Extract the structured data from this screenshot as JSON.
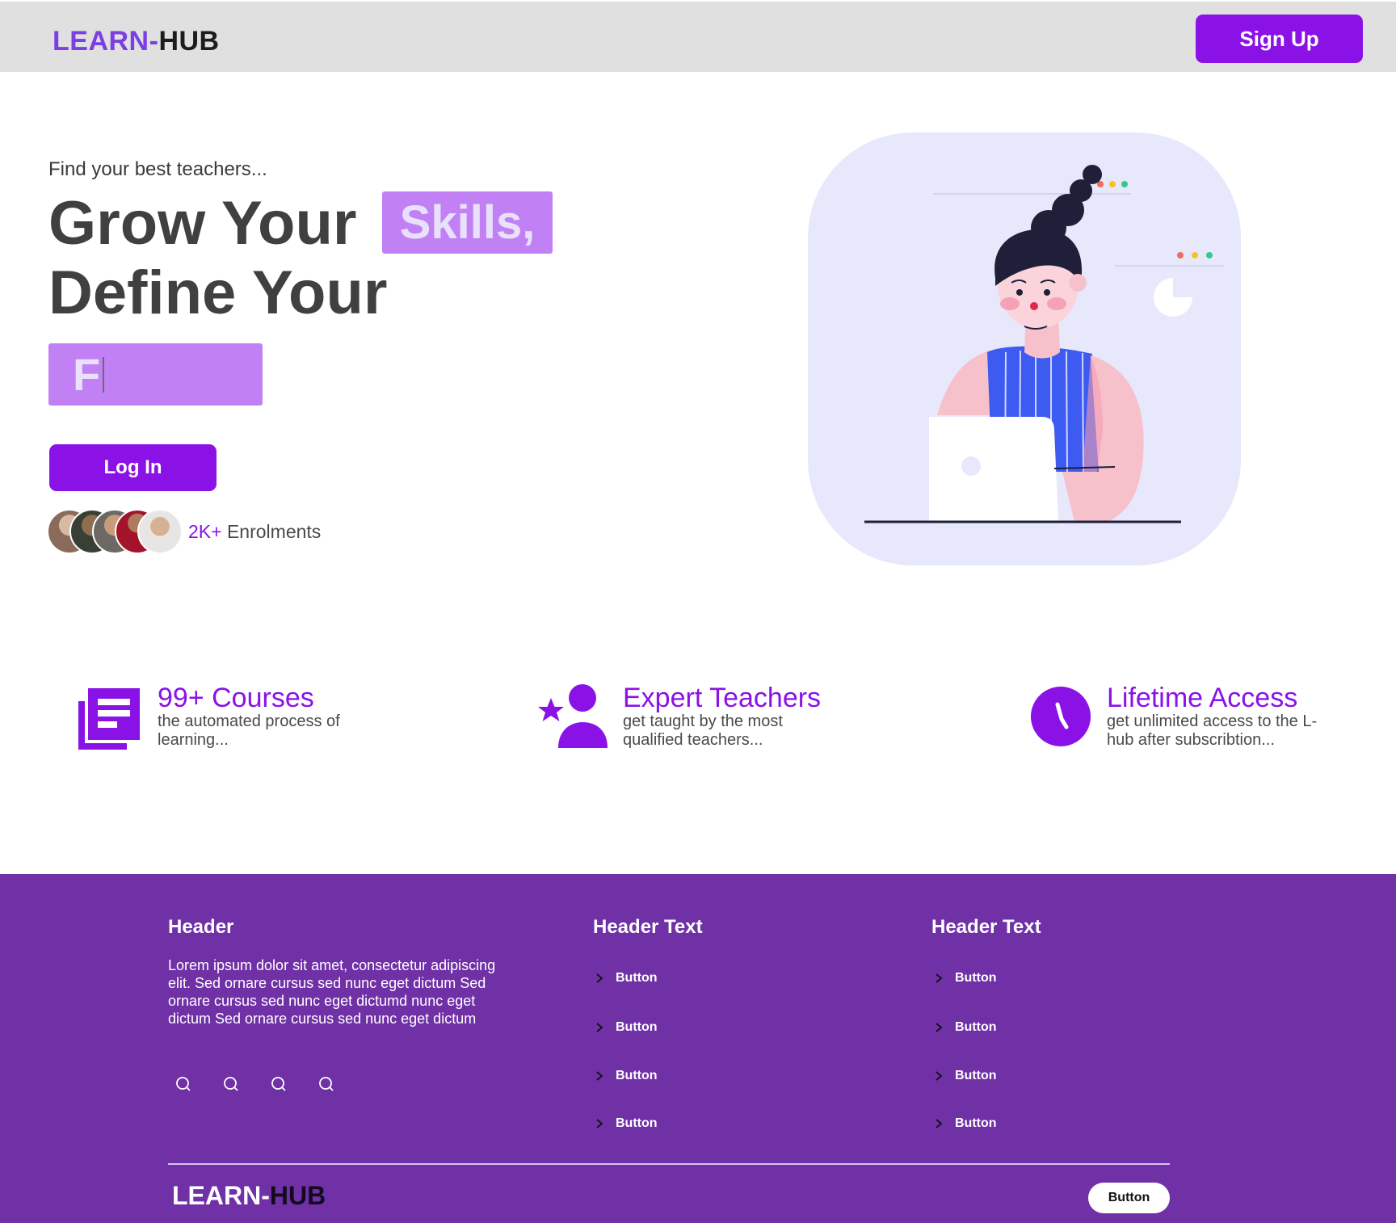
{
  "header": {
    "brand_part1": "LEARN-",
    "brand_part2": "HUB",
    "signup_label": "Sign Up"
  },
  "hero": {
    "tagline": "Find your best teachers...",
    "headline_line1": "Grow Your",
    "highlight_word": "Skills,",
    "headline_line2": "Define Your",
    "typing_text": "F",
    "login_label": "Log In",
    "enrol_count": "2K+",
    "enrol_label": "Enrolments"
  },
  "features": [
    {
      "title": "99+ Courses",
      "description": "the automated process of learning...",
      "icon": "book-stack-icon"
    },
    {
      "title": "Expert Teachers",
      "description": "get taught by the most qualified teachers...",
      "icon": "teacher-star-icon"
    },
    {
      "title": "Lifetime Access",
      "description": "get unlimited access to the L-hub after subscribtion...",
      "icon": "clock-icon"
    }
  ],
  "footer": {
    "col1_header": "Header",
    "col1_text": "Lorem ipsum dolor sit amet, consectetur adipiscing elit. Sed ornare cursus sed nunc eget dictum  Sed ornare cursus sed nunc eget dictumd nunc eget dictum  Sed ornare cursus sed nunc eget dictum",
    "col2_header": "Header Text",
    "col3_header": "Header Text",
    "col2_links": [
      "Button",
      "Button",
      "Button",
      "Button"
    ],
    "col3_links": [
      "Button",
      "Button",
      "Button",
      "Button"
    ],
    "brand_part1": "LEARN-",
    "brand_part2": "HUB",
    "button_label": "Button"
  },
  "colors": {
    "accent": "#8a12e6",
    "highlight": "#c181f5",
    "footer_bg": "#7030a6",
    "header_bg": "#e0e0e0"
  }
}
